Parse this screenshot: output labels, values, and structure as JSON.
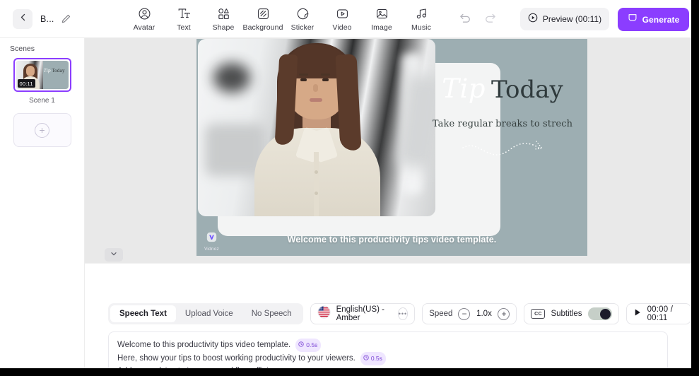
{
  "topbar": {
    "back_icon": "chevron-left-icon",
    "project_title": "B...",
    "edit_icon": "pencil-icon",
    "tools": [
      {
        "id": "avatar",
        "label": "Avatar",
        "icon": "avatar-icon"
      },
      {
        "id": "text",
        "label": "Text",
        "icon": "text-icon"
      },
      {
        "id": "shape",
        "label": "Shape",
        "icon": "shape-icon"
      },
      {
        "id": "background",
        "label": "Background",
        "icon": "background-icon"
      },
      {
        "id": "sticker",
        "label": "Sticker",
        "icon": "sticker-icon"
      },
      {
        "id": "video",
        "label": "Video",
        "icon": "video-icon"
      },
      {
        "id": "image",
        "label": "Image",
        "icon": "image-icon"
      },
      {
        "id": "music",
        "label": "Music",
        "icon": "music-icon"
      }
    ],
    "undo_icon": "undo-icon",
    "redo_icon": "redo-icon",
    "preview_label": "Preview (00:11)",
    "preview_icon": "play-circle-icon",
    "generate_label": "Generate",
    "generate_icon": "generate-icon",
    "accent_purple": "#8b3dff"
  },
  "scenes": {
    "title": "Scenes",
    "items": [
      {
        "label": "Scene 1",
        "duration": "00:11"
      }
    ],
    "add_scene_icon": "plus-icon"
  },
  "canvas": {
    "background_color": "#9daeb2",
    "headline_script": "Tip",
    "headline_regular": "Today",
    "subheadline": "Take regular breaks to strech",
    "squiggle_icon": "dotted-squiggle-icon",
    "subtitle": "Welcome to this productivity tips video template.",
    "watermark_name": "Vidnoz",
    "watermark_icon": "vidnoz-logo-icon",
    "collapse_icon": "chevron-down-icon"
  },
  "bottom": {
    "modes": [
      {
        "label": "Speech Text",
        "active": true
      },
      {
        "label": "Upload Voice",
        "active": false
      },
      {
        "label": "No Speech",
        "active": false
      }
    ],
    "voice": {
      "flag_icon": "us-flag-icon",
      "name": "English(US) - Amber",
      "more_icon": "more-options-icon"
    },
    "speed": {
      "label": "Speed",
      "minus_icon": "minus-icon",
      "value": "1.0x",
      "plus_icon": "plus-icon"
    },
    "subtitles": {
      "cc_icon": "cc-icon",
      "label": "Subtitles",
      "enabled": true
    },
    "playback": {
      "play_icon": "play-icon",
      "time": "00:00 / 00:11"
    },
    "script": {
      "lines": [
        {
          "text": "Welcome to this productivity tips video template.",
          "pause": "0.5s"
        },
        {
          "text": "Here, show your tips to boost working productivity to your viewers.",
          "pause": "0.5s"
        },
        {
          "text": "Add your advice to improve workflow efficiency now.",
          "pause": null
        }
      ],
      "pause_icon": "clock-icon"
    }
  }
}
